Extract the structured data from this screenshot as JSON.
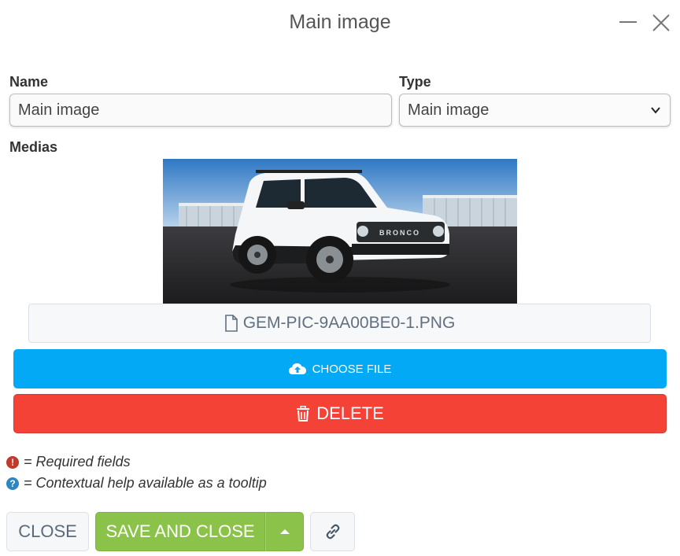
{
  "dialog": {
    "title": "Main image"
  },
  "form": {
    "name_label": "Name",
    "name_value": "Main image",
    "type_label": "Type",
    "type_value": "Main image",
    "medias_label": "Medias"
  },
  "media": {
    "file_name": "GEM-PIC-9AA00BE0-1.PNG",
    "choose_label": "CHOOSE FILE",
    "delete_label": "DELETE"
  },
  "legend": {
    "required_text": "= Required fields",
    "help_text": "= Contextual help available as a tooltip"
  },
  "footer": {
    "close_label": "CLOSE",
    "save_label": "SAVE AND CLOSE"
  },
  "colors": {
    "choose": "#03a9f4",
    "delete": "#f44336",
    "save": "#8bc34a",
    "required_icon": "#c0392b",
    "help_icon": "#2e86c1"
  },
  "icons": {
    "minimize": "minimize-icon",
    "close": "close-icon",
    "file": "file-icon",
    "upload": "cloud-upload-icon",
    "trash": "trash-icon",
    "caret": "caret-up-icon",
    "link": "link-icon"
  }
}
